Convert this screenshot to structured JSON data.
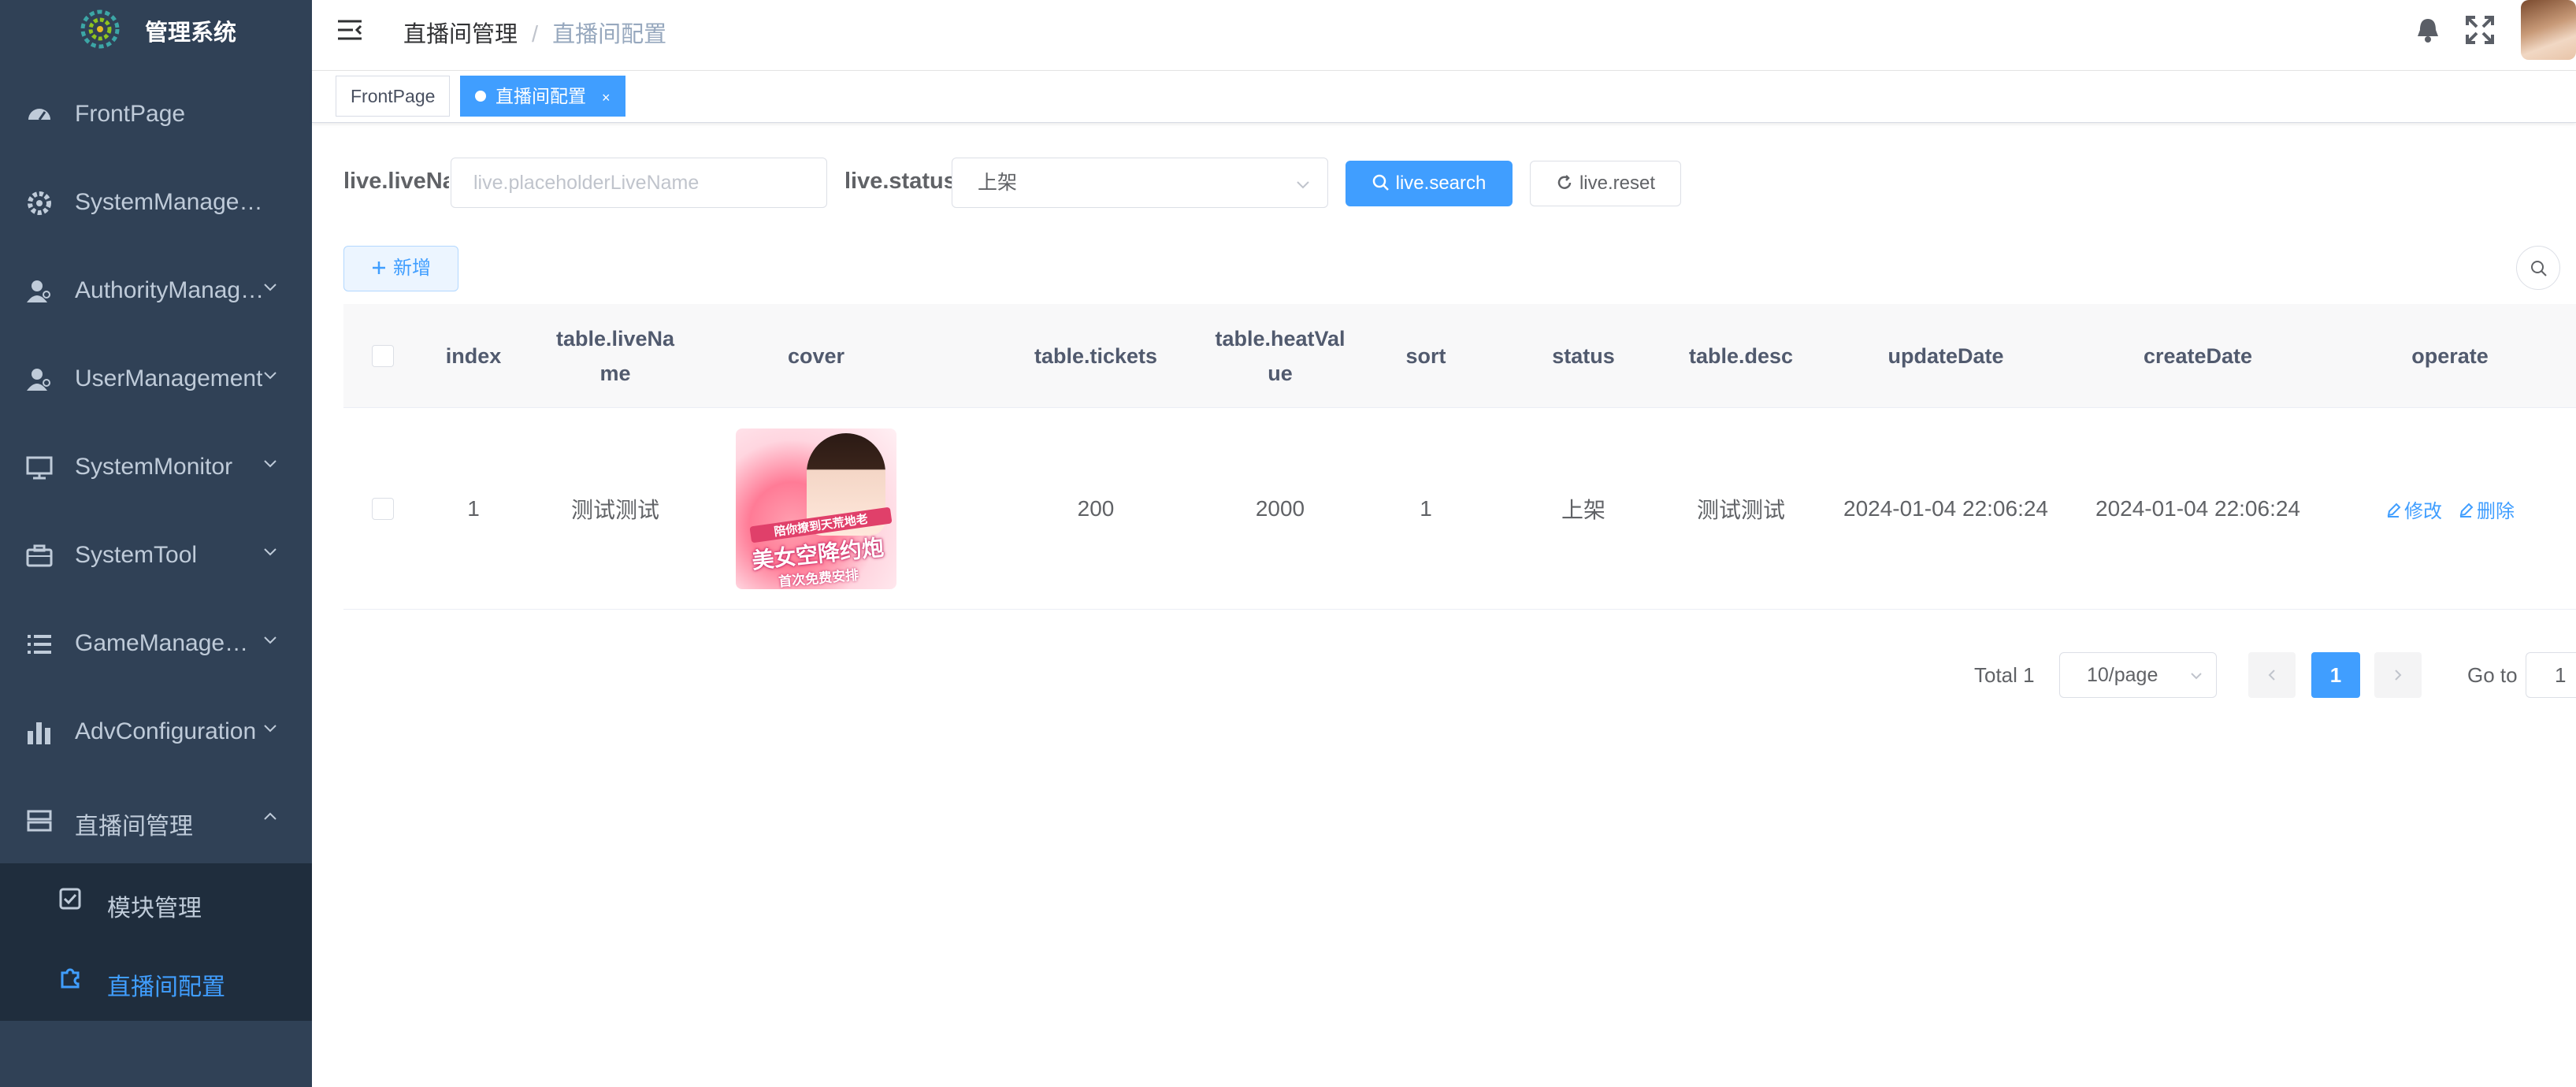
{
  "app": {
    "title": "管理系统"
  },
  "sidebar": {
    "items": [
      {
        "label": "FrontPage",
        "icon": "dashboard-icon"
      },
      {
        "label": "SystemManagement",
        "icon": "gear-icon"
      },
      {
        "label": "AuthorityManagement",
        "icon": "user-icon"
      },
      {
        "label": "UserManagement",
        "icon": "user-icon"
      },
      {
        "label": "SystemMonitor",
        "icon": "monitor-icon"
      },
      {
        "label": "SystemTool",
        "icon": "toolbox-icon"
      },
      {
        "label": "GameManagement",
        "icon": "list-icon"
      },
      {
        "label": "AdvConfiguration",
        "icon": "bar-chart-icon"
      },
      {
        "label": "直播间管理",
        "icon": "server-icon"
      }
    ],
    "sub_items": [
      {
        "label": "模块管理",
        "icon": "checkbox-icon"
      },
      {
        "label": "直播间配置",
        "icon": "puzzle-icon"
      }
    ]
  },
  "header": {
    "breadcrumb": [
      "直播间管理",
      "直播间配置"
    ]
  },
  "tags": [
    {
      "label": "FrontPage"
    },
    {
      "label": "直播间配置"
    }
  ],
  "search": {
    "live_name_label": "live.liveName",
    "live_name_placeholder": "live.placeholderLiveName",
    "status_label": "live.status",
    "status_value": "上架",
    "search_button": "live.search",
    "reset_button": "live.reset"
  },
  "toolbar": {
    "add_button": "新增"
  },
  "table": {
    "columns": [
      "index",
      "table.liveName",
      "cover",
      "table.tickets",
      "table.heatValue",
      "sort",
      "status",
      "table.desc",
      "updateDate",
      "createDate",
      "operate"
    ],
    "rows": [
      {
        "index": "1",
        "liveName": "测试测试",
        "cover": {
          "banner": "陪你撩到天荒地老",
          "headline": "美女空降约炮",
          "footer": "首次免费安排"
        },
        "tickets": "200",
        "heatValue": "2000",
        "sort": "1",
        "status": "上架",
        "desc": "测试测试",
        "updateDate": "2024-01-04 22:06:24",
        "createDate": "2024-01-04 22:06:24",
        "actions": [
          "修改",
          "删除"
        ]
      }
    ]
  },
  "pagination": {
    "total": "Total 1",
    "page_size": "10/page",
    "current_page": "1",
    "goto_label": "Go to",
    "goto_value": "1"
  },
  "colors": {
    "sidebar_bg": "#304156",
    "submenu_bg": "#1f2d3d",
    "accent": "#409eff",
    "menu_text": "#bfcbd9"
  }
}
